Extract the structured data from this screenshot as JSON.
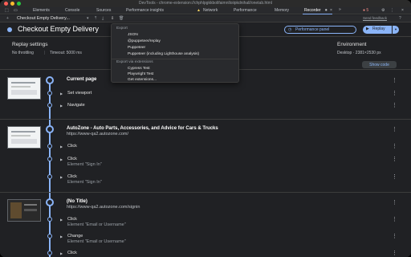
{
  "window": {
    "title": "DevTools - chrome-extension://chphlpgkkbolifaimnlloiipkdnihall/onetab.html"
  },
  "devtools_tabs": {
    "items": [
      "Elements",
      "Console",
      "Sources",
      "Performance insights",
      "Network",
      "Performance",
      "Memory",
      "Recorder"
    ],
    "active": "Recorder",
    "errors": "5"
  },
  "recorder_toolbar": {
    "selected_recording": "Checkout Empty Delivery...",
    "send_feedback": "Send feedback"
  },
  "header": {
    "title": "Checkout Empty Delivery",
    "performance_panel": "Performance panel",
    "replay": "Replay"
  },
  "settings": {
    "replay_settings": "Replay settings",
    "throttling": "No throttling",
    "timeout": "Timeout: 5000 ms",
    "environment": "Environment",
    "environment_value": "Desktop · 2381×2530 px",
    "show_code": "Show code"
  },
  "export_menu": {
    "export_header": "Export",
    "items": [
      "JSON",
      "@puppeteer/replay",
      "Puppeteer",
      "Puppeteer (including Lighthouse analysis)"
    ],
    "ext_header": "Export via extensions",
    "ext_items": [
      "Cypress Test",
      "Playwright Test",
      "Get extensions..."
    ]
  },
  "sections": [
    {
      "title": "Current page",
      "url": "",
      "steps": [
        {
          "label": "Set viewport",
          "sub": ""
        },
        {
          "label": "Navigate",
          "sub": ""
        }
      ]
    },
    {
      "title": "AutoZone - Auto Parts, Accessories, and Advice for Cars & Trucks",
      "url": "https://www-qa2.autozone.com/",
      "steps": [
        {
          "label": "Click",
          "sub": ""
        },
        {
          "label": "Click",
          "sub": "Element \"Sign In\""
        },
        {
          "label": "Click",
          "sub": "Element \"Sign In\""
        }
      ]
    },
    {
      "title": "(No Title)",
      "url": "https://www-qa2.autozone.com/signin",
      "steps": [
        {
          "label": "Click",
          "sub": "Element \"Email or Username\""
        },
        {
          "label": "Change",
          "sub": "Element \"Email or Username\""
        },
        {
          "label": "Click",
          "sub": ""
        }
      ]
    }
  ],
  "colors": {
    "accent": "#8ab4f8",
    "background": "#202124",
    "panel": "#292a2d"
  }
}
